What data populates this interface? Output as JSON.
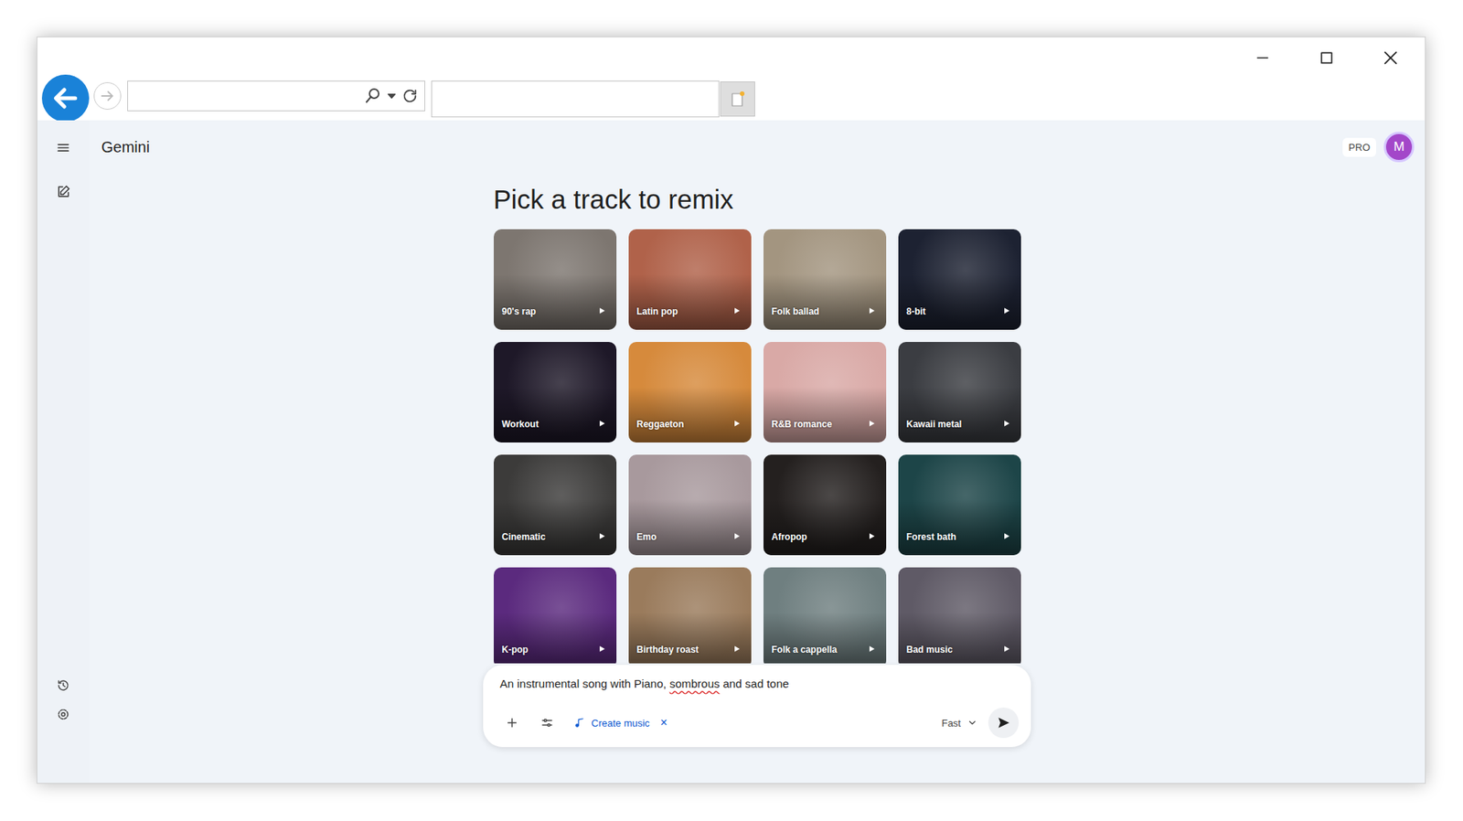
{
  "app": {
    "title": "Gemini",
    "badge": "PRO",
    "avatar": "M"
  },
  "heading": "Pick a track to remix",
  "tracks": [
    {
      "label": "90's rap",
      "color": "#7d7670"
    },
    {
      "label": "Latin pop",
      "color": "#b0624a"
    },
    {
      "label": "Folk ballad",
      "color": "#a39580"
    },
    {
      "label": "8-bit",
      "color": "#1d2232"
    },
    {
      "label": "Workout",
      "color": "#1e1828"
    },
    {
      "label": "Reggaeton",
      "color": "#d68a3c"
    },
    {
      "label": "R&B romance",
      "color": "#d9a9a6"
    },
    {
      "label": "Kawaii metal",
      "color": "#3b3d42"
    },
    {
      "label": "Cinematic",
      "color": "#3c3b3a"
    },
    {
      "label": "Emo",
      "color": "#a8999d"
    },
    {
      "label": "Afropop",
      "color": "#24201f"
    },
    {
      "label": "Forest bath",
      "color": "#1d4548"
    },
    {
      "label": "K-pop",
      "color": "#5b2a7e"
    },
    {
      "label": "Birthday roast",
      "color": "#9a7b5c"
    },
    {
      "label": "Folk a cappella",
      "color": "#6f7f80"
    },
    {
      "label": "Bad music",
      "color": "#5f5a66"
    }
  ],
  "prompt": {
    "value": "An instrumental song with Piano, sombrous and sad tone",
    "misspelled": "sombrous"
  },
  "tool": {
    "label": "Create music",
    "close": "×"
  },
  "mode": {
    "label": "Fast"
  }
}
